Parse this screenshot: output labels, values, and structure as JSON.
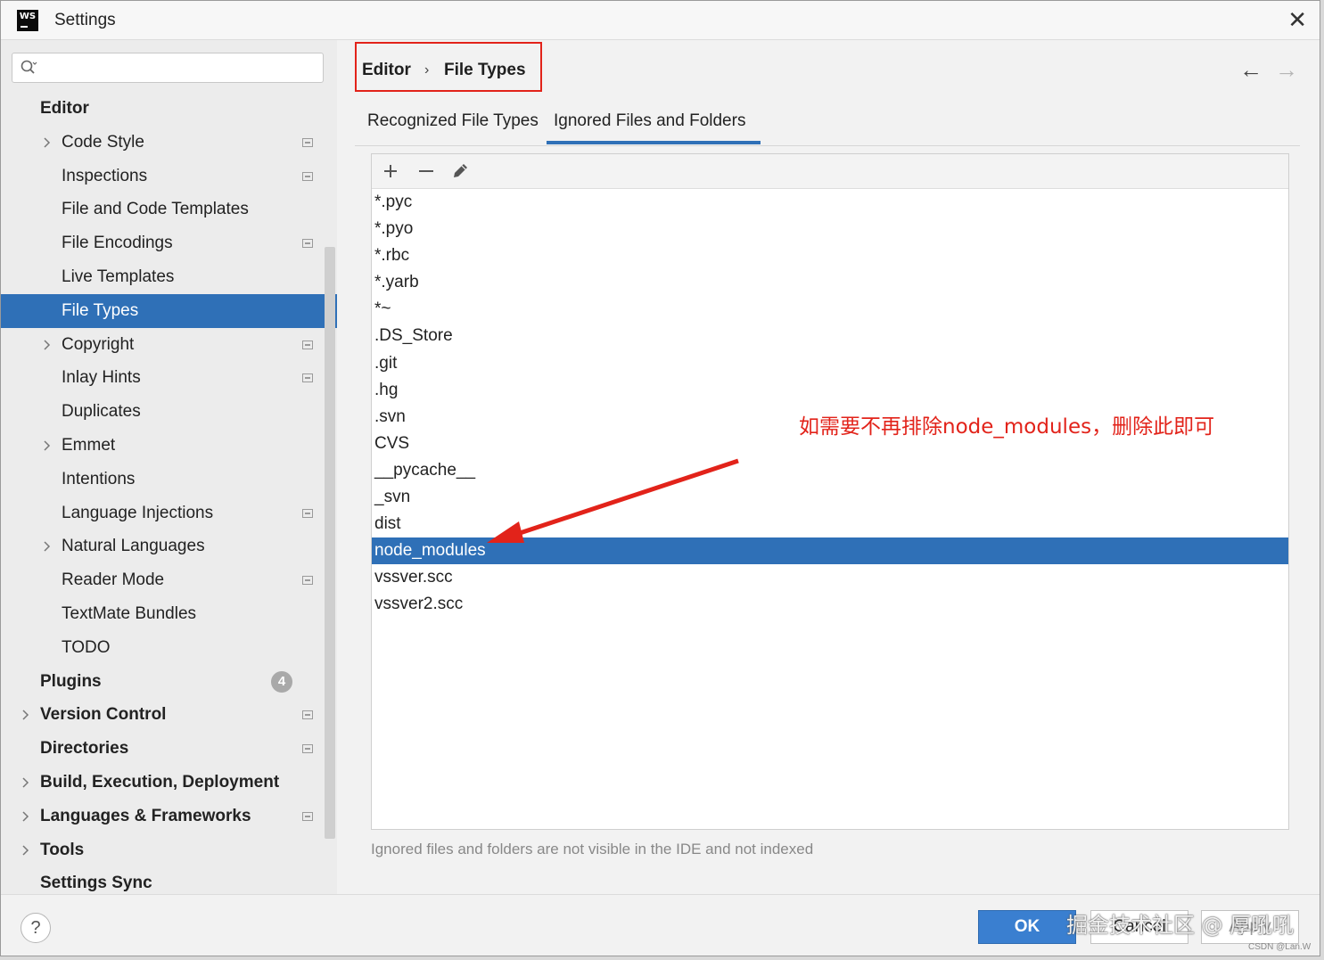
{
  "window": {
    "title": "Settings",
    "app_icon_text": "WS"
  },
  "search": {
    "placeholder": "",
    "value": ""
  },
  "sidebar": {
    "items": [
      {
        "label": "Editor",
        "level": 0,
        "bold": true
      },
      {
        "label": "Code Style",
        "level": 1,
        "expandable": true,
        "project": true
      },
      {
        "label": "Inspections",
        "level": 1,
        "project": true
      },
      {
        "label": "File and Code Templates",
        "level": 1
      },
      {
        "label": "File Encodings",
        "level": 1,
        "project": true
      },
      {
        "label": "Live Templates",
        "level": 1
      },
      {
        "label": "File Types",
        "level": 1,
        "selected": true
      },
      {
        "label": "Copyright",
        "level": 1,
        "expandable": true,
        "project": true
      },
      {
        "label": "Inlay Hints",
        "level": 1,
        "project": true
      },
      {
        "label": "Duplicates",
        "level": 1
      },
      {
        "label": "Emmet",
        "level": 1,
        "expandable": true
      },
      {
        "label": "Intentions",
        "level": 1
      },
      {
        "label": "Language Injections",
        "level": 1,
        "project": true
      },
      {
        "label": "Natural Languages",
        "level": 1,
        "expandable": true
      },
      {
        "label": "Reader Mode",
        "level": 1,
        "project": true
      },
      {
        "label": "TextMate Bundles",
        "level": 1
      },
      {
        "label": "TODO",
        "level": 1
      },
      {
        "label": "Plugins",
        "level": 0,
        "bold": true,
        "badge": "4"
      },
      {
        "label": "Version Control",
        "level": 0,
        "bold": true,
        "expandable": true,
        "project": true
      },
      {
        "label": "Directories",
        "level": 0,
        "bold": true,
        "project": true
      },
      {
        "label": "Build, Execution, Deployment",
        "level": 0,
        "bold": true,
        "expandable": true
      },
      {
        "label": "Languages & Frameworks",
        "level": 0,
        "bold": true,
        "expandable": true,
        "project": true
      },
      {
        "label": "Tools",
        "level": 0,
        "bold": true,
        "expandable": true
      },
      {
        "label": "Settings Sync",
        "level": 0,
        "bold": true
      }
    ]
  },
  "breadcrumb": {
    "parent": "Editor",
    "separator": "›",
    "current": "File Types"
  },
  "nav": {
    "back": "←",
    "forward": "→"
  },
  "tabs": {
    "recognized": "Recognized File Types",
    "ignored": "Ignored Files and Folders",
    "active": "ignored"
  },
  "ignored_list": {
    "items": [
      "*.pyc",
      "*.pyo",
      "*.rbc",
      "*.yarb",
      "*~",
      ".DS_Store",
      ".git",
      ".hg",
      ".svn",
      "CVS",
      "__pycache__",
      "_svn",
      "dist",
      "node_modules",
      "vssver.scc",
      "vssver2.scc"
    ],
    "selected": "node_modules"
  },
  "annotation": {
    "text": "如需要不再排除node_modules，删除此即可",
    "color": "#e2231a"
  },
  "hint": "Ignored files and folders are not visible in the IDE and not indexed",
  "footer": {
    "help": "?",
    "ok": "OK",
    "cancel": "Cancel",
    "apply": "Apply"
  },
  "watermark": {
    "text": "掘金技术社区 @ 厚吼吼",
    "csdn": "CSDN @Lan.W"
  },
  "colors": {
    "accent": "#2f70b7",
    "annotation_red": "#e2231a",
    "ok_button": "#3a7fd0"
  }
}
